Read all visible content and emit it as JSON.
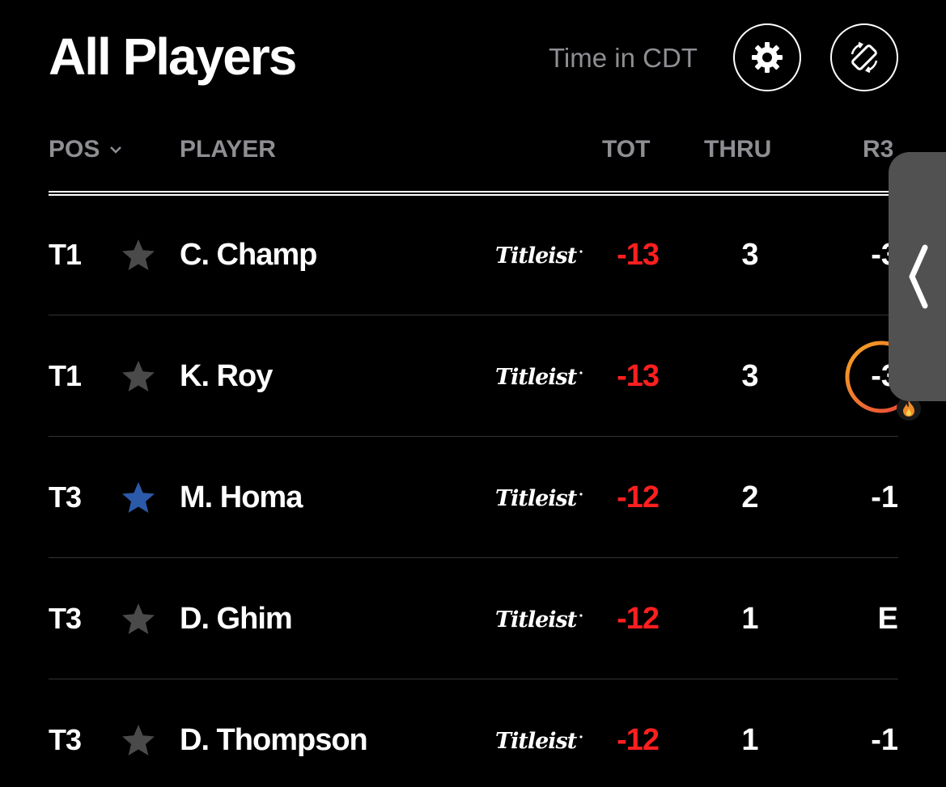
{
  "header": {
    "title": "All Players",
    "time_label": "Time in CDT",
    "settings_icon": "gear-icon",
    "rotate_icon": "rotate-device-icon"
  },
  "columns": {
    "pos": "POS",
    "player": "PLAYER",
    "tot": "TOT",
    "thru": "THRU",
    "r3": "R3"
  },
  "colors": {
    "under_par": "#ff1f1f",
    "favorite_star": "#2b5aa8",
    "default_star": "#4a4a4a",
    "muted_text": "#8e8e93",
    "hot_ring_start": "#f5a623",
    "hot_ring_end": "#e8423a"
  },
  "rows": [
    {
      "pos": "T1",
      "name": "C. Champ",
      "sponsor": "Titleist",
      "favorite": false,
      "tot": "-13",
      "thru": "3",
      "r3": "-3"
    },
    {
      "pos": "T1",
      "name": "K. Roy",
      "sponsor": "Titleist",
      "favorite": false,
      "tot": "-13",
      "thru": "3",
      "r3": "-3",
      "hot": true
    },
    {
      "pos": "T3",
      "name": "M. Homa",
      "sponsor": "Titleist",
      "favorite": true,
      "tot": "-12",
      "thru": "2",
      "r3": "-1"
    },
    {
      "pos": "T3",
      "name": "D. Ghim",
      "sponsor": "Titleist",
      "favorite": false,
      "tot": "-12",
      "thru": "1",
      "r3": "E"
    },
    {
      "pos": "T3",
      "name": "D. Thompson",
      "sponsor": "Titleist",
      "favorite": false,
      "tot": "-12",
      "thru": "1",
      "r3": "-1"
    }
  ],
  "side_panel": {
    "icon": "chevron-left-icon"
  }
}
